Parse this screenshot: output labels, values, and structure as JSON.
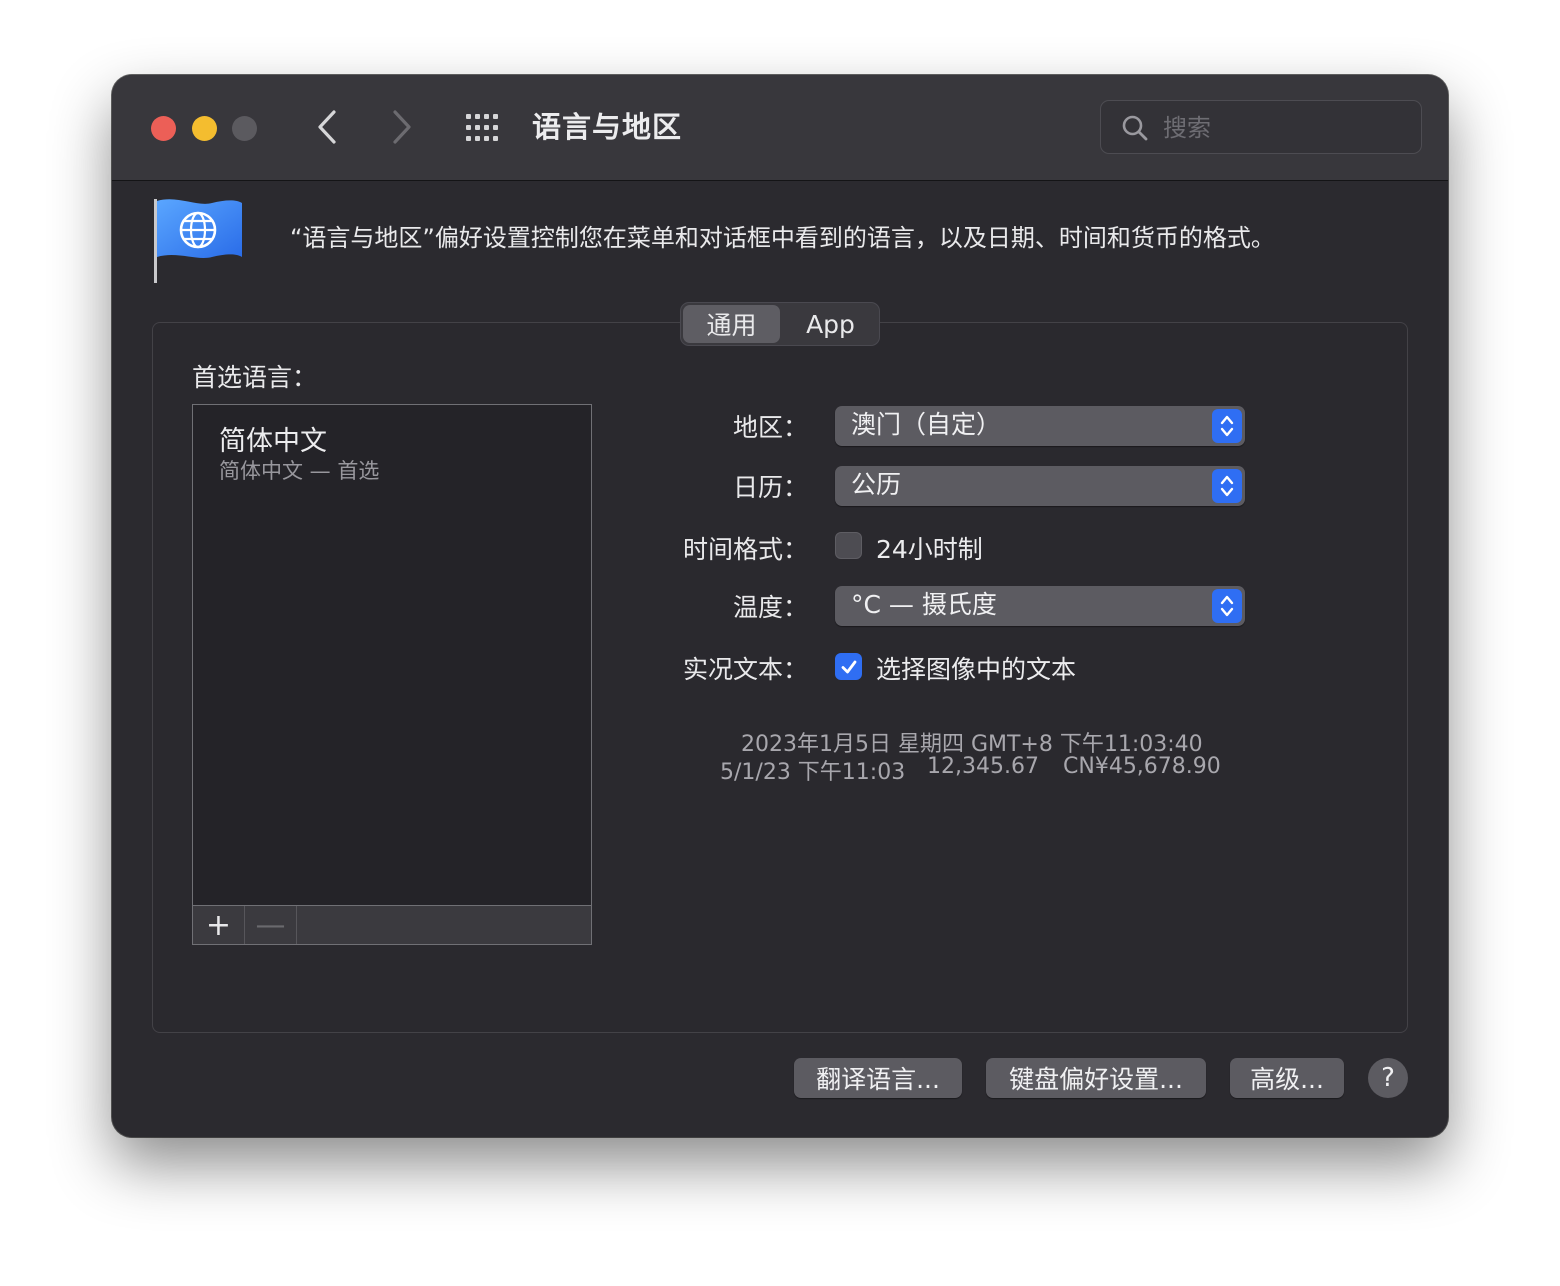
{
  "window": {
    "title": "语言与地区"
  },
  "search": {
    "placeholder": "搜索"
  },
  "header": {
    "description": "“语言与地区”偏好设置控制您在菜单和对话框中看到的语言，以及日期、时间和货币的格式。"
  },
  "tabs": [
    {
      "label": "通用",
      "active": true
    },
    {
      "label": "App",
      "active": false
    }
  ],
  "preferred_languages": {
    "label": "首选语言：",
    "items": [
      {
        "title": "简体中文",
        "subtitle": "简体中文 — 首选"
      }
    ],
    "add_label": "+",
    "remove_label": "—"
  },
  "settings": {
    "region": {
      "label": "地区：",
      "value": "澳门（自定）"
    },
    "calendar": {
      "label": "日历：",
      "value": "公历"
    },
    "time_format": {
      "label": "时间格式：",
      "checkbox_label": "24小时制",
      "checked": false
    },
    "temperature": {
      "label": "温度：",
      "value": "°C — 摄氏度"
    },
    "live_text": {
      "label": "实况文本：",
      "checkbox_label": "选择图像中的文本",
      "checked": true
    }
  },
  "samples": {
    "line1": "2023年1月5日 星期四 GMT+8 下午11:03:40",
    "date_short": "5/1/23 下午11:03",
    "number": "12,345.67",
    "currency": "CN¥45,678.90"
  },
  "buttons": {
    "translate": "翻译语言...",
    "keyboard": "键盘偏好设置...",
    "advanced": "高级...",
    "help": "?"
  },
  "colors": {
    "accent": "#2f6ef3",
    "window_bg": "#2b2a2f",
    "titlebar_bg": "#38373c"
  }
}
